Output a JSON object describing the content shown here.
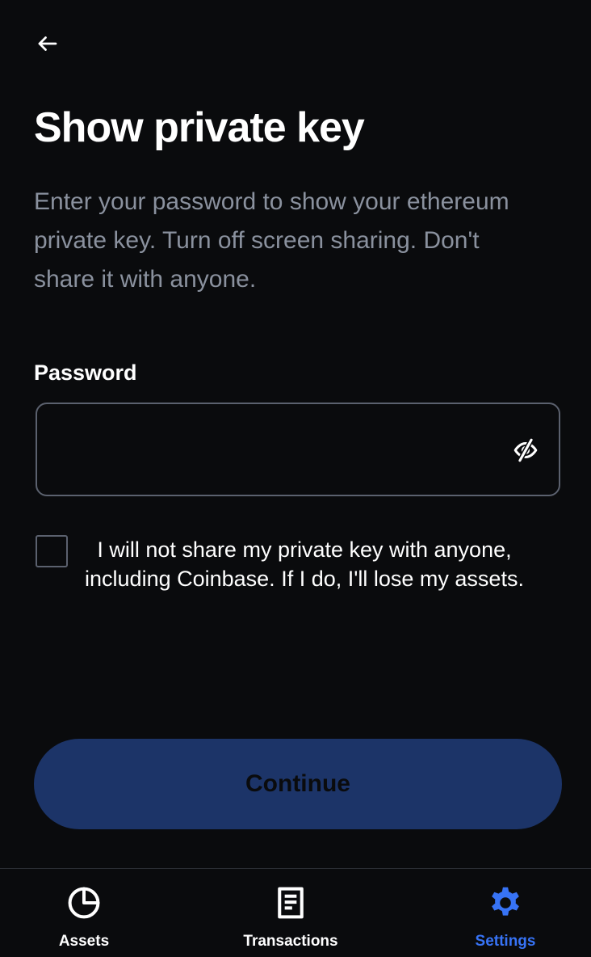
{
  "header": {
    "title": "Show private key",
    "subtitle": "Enter your password to show your ethereum private key. Turn off screen sharing. Don't share it with anyone."
  },
  "password": {
    "label": "Password",
    "value": "",
    "placeholder": ""
  },
  "agreement": {
    "text": "I will not share my private key with anyone, including Coinbase. If I do, I'll lose my assets.",
    "checked": false
  },
  "continue_button": {
    "label": "Continue"
  },
  "tab_bar": {
    "tabs": [
      {
        "label": "Assets",
        "icon": "pie-chart-icon"
      },
      {
        "label": "Transactions",
        "icon": "document-icon"
      },
      {
        "label": "Settings",
        "icon": "gear-icon"
      }
    ],
    "active": "Settings"
  },
  "colors": {
    "background": "#0a0b0d",
    "secondary_text": "#8a919e",
    "border": "#5b616e",
    "button_disabled": "#1c3468",
    "accent": "#3773f5"
  },
  "icons": {
    "back": "arrow-left-icon",
    "visibility": "eye-off-icon"
  }
}
